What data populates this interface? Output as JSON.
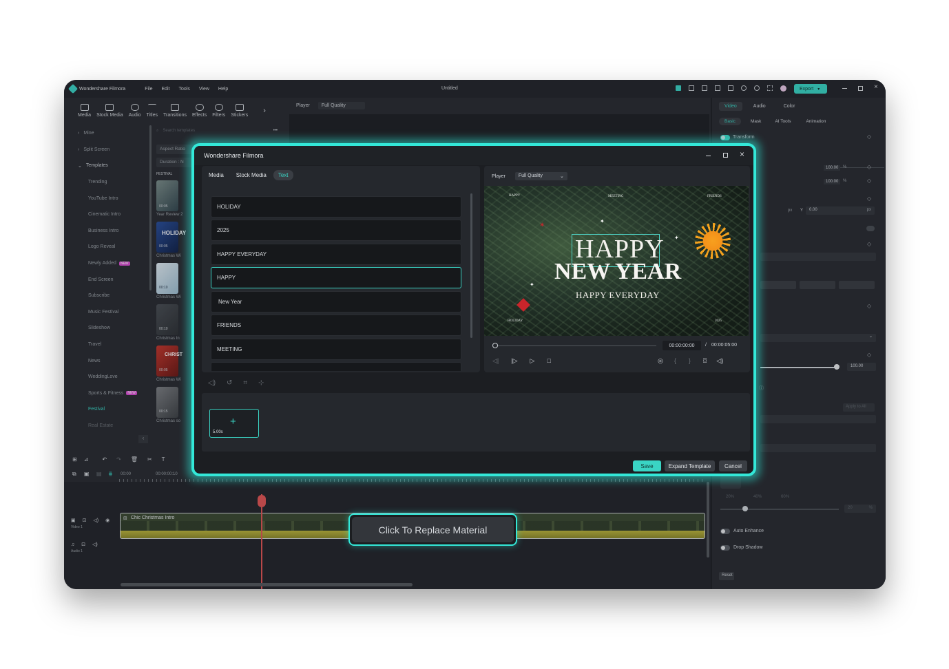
{
  "window": {
    "app_name": "Wondershare Filmora",
    "title": "Untitled",
    "menu": [
      "File",
      "Edit",
      "Tools",
      "View",
      "Help"
    ],
    "export_label": "Export"
  },
  "toolbar": {
    "items": [
      "Media",
      "Stock Media",
      "Audio",
      "Titles",
      "Transitions",
      "Effects",
      "Filters",
      "Stickers"
    ]
  },
  "sidebar": {
    "items": [
      "Mine",
      "Split Screen",
      "Templates",
      "Trending",
      "YouTube Intro",
      "Cinematic Intro",
      "Business Intro",
      "Logo Reveal",
      "Newly Added",
      "End Screen",
      "Subscribe",
      "Music Festival",
      "Slideshow",
      "Travel",
      "News",
      "WeddingLove",
      "Sports & Fitness",
      "Festival",
      "Real Estate"
    ],
    "new_badge": "NEW"
  },
  "templates": {
    "search_placeholder": "Search templates",
    "aspect_label": "Aspect Ratio",
    "duration_label": "Duration : N",
    "section": "FESTIVAL",
    "thumbs": [
      {
        "label": "Year Review 2",
        "time": "00:05"
      },
      {
        "label": "Christmas Wi",
        "time": "00:05"
      },
      {
        "label": "Christmas Wi",
        "time": "00:10"
      },
      {
        "label": "Christmas In",
        "time": "00:10"
      },
      {
        "label": "Christmas Wi",
        "time": "00:05"
      },
      {
        "label": "Christmas so",
        "time": "00:15"
      }
    ]
  },
  "player_bar": {
    "label": "Player",
    "quality": "Full Quality"
  },
  "properties": {
    "tabs": [
      "Video",
      "Audio",
      "Color"
    ],
    "subtabs": [
      "Basic",
      "Mask",
      "AI Tools",
      "Animation"
    ],
    "transform_label": "Transform",
    "scale_x": "100.00",
    "scale_y": "100.00",
    "percent": "%",
    "px": "px",
    "y_label": "Y",
    "y_value": "0.00",
    "opacity_value": "100.00",
    "apply_all": "Apply to All",
    "pct_marks": [
      "20%",
      "40%",
      "60%"
    ],
    "slider_value": "20",
    "auto_enhance": "Auto Enhance",
    "drop_shadow": "Drop Shadow",
    "reset": "Reset"
  },
  "timeline": {
    "time_start": "00:00",
    "time_mark": "00:00:00:10",
    "video_track": "Video 1",
    "audio_track": "Audio 1",
    "clip_label": "Chic Christmas Intro",
    "replace_label": "Click To Replace Material"
  },
  "modal": {
    "title": "Wondershare Filmora",
    "tabs": [
      "Media",
      "Stock Media",
      "Text"
    ],
    "active_tab": "Text",
    "text_items": [
      "HOLIDAY",
      "2025",
      "HAPPY EVERYDAY",
      "HAPPY",
      "New Year",
      "FRIENDS",
      "MEETING"
    ],
    "selected_index": 3,
    "player_label": "Player",
    "quality": "Full Quality",
    "preview": {
      "line1": "HAPPY",
      "line2": "NEW YEAR",
      "line3": "HAPPY EVERYDAY",
      "corner_tl": "HAPPY",
      "corner_tc": "MEETING",
      "corner_tr": "FRIENDS",
      "corner_bl": "HOLIDAY",
      "corner_br": "2025"
    },
    "current_time": "00:00:00:00",
    "separator": "/",
    "total_time": "00:00:05:00",
    "slot_duration": "5.00s",
    "save_label": "Save",
    "expand_label": "Expand Template",
    "cancel_label": "Cancel"
  },
  "colors": {
    "accent": "#33e8d8",
    "save": "#3ad4c4",
    "playhead": "#e05656"
  }
}
